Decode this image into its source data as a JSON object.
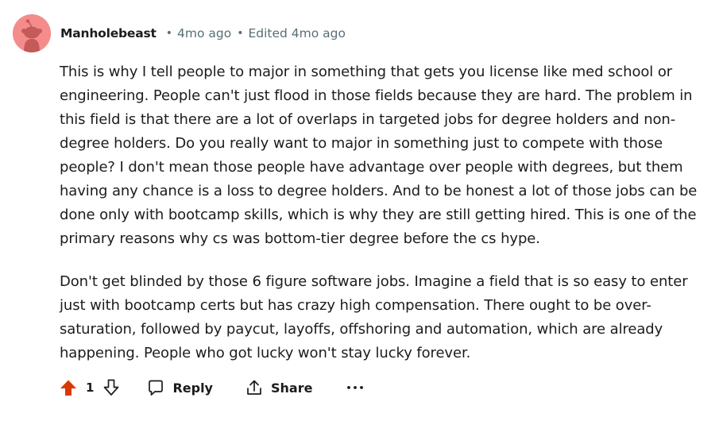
{
  "comment": {
    "username": "Manholebeast",
    "separator": "•",
    "time": "4mo ago",
    "edited": "Edited 4mo ago",
    "paragraphs": [
      "This is why I tell people to major in something that gets you license like med school or engineering. People can't just flood in those fields because they are hard. The problem in this field is that there are a lot of overlaps in targeted jobs for degree holders and non-degree holders. Do you really want to major in something just to compete with those people? I don't mean those people have advantage over people with degrees, but them having any chance is a loss to degree holders. And to be honest a lot of those jobs can be done only with bootcamp skills, which is why they are still getting hired. This is one of the primary reasons why cs was bottom-tier degree before the cs hype.",
      "Don't get blinded by those 6 figure software jobs. Imagine a field that is so easy to enter just with bootcamp certs but has crazy high compensation. There ought to be over-saturation, followed by paycut, layoffs, offshoring and automation, which are already happening. People who got lucky won't stay lucky forever."
    ]
  },
  "actions": {
    "score": "1",
    "reply_label": "Reply",
    "share_label": "Share",
    "more_label": "•••"
  },
  "icons": {
    "avatar": "snoo-avatar-icon",
    "upvote": "upvote-arrow-icon",
    "downvote": "downvote-arrow-icon",
    "reply": "speech-bubble-icon",
    "share": "share-icon"
  },
  "colors": {
    "upvote_active": "#d93900",
    "meta_text": "#576f76",
    "avatar_bg": "#f58c8c"
  }
}
